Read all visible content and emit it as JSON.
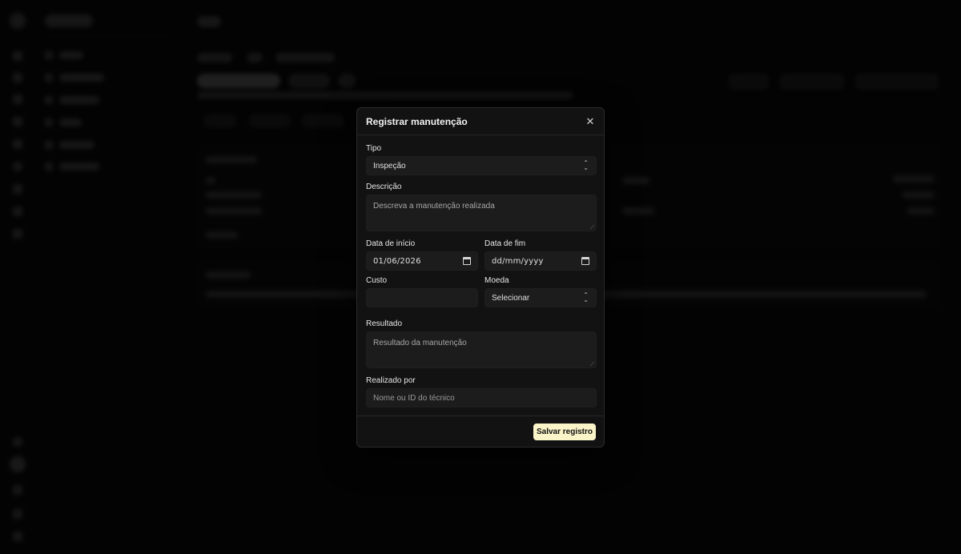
{
  "modal": {
    "title": "Registrar manutenção",
    "close_icon": "close-icon",
    "fields": {
      "tipo": {
        "label": "Tipo",
        "value": "Inspeção"
      },
      "descricao": {
        "label": "Descrição",
        "placeholder": "Descreva a manutenção realizada"
      },
      "data_inicio": {
        "label": "Data de início",
        "value": "01/06/2026"
      },
      "data_fim": {
        "label": "Data de fim",
        "placeholder": "dd/mm/yyyy"
      },
      "custo": {
        "label": "Custo",
        "value": ""
      },
      "moeda": {
        "label": "Moeda",
        "value": "Selecionar"
      },
      "resultado": {
        "label": "Resultado",
        "placeholder": "Resultado da manutenção"
      },
      "realizado_por": {
        "label": "Realizado por",
        "placeholder": "Nome ou ID do técnico"
      }
    },
    "save_label": "Salvar registro"
  }
}
